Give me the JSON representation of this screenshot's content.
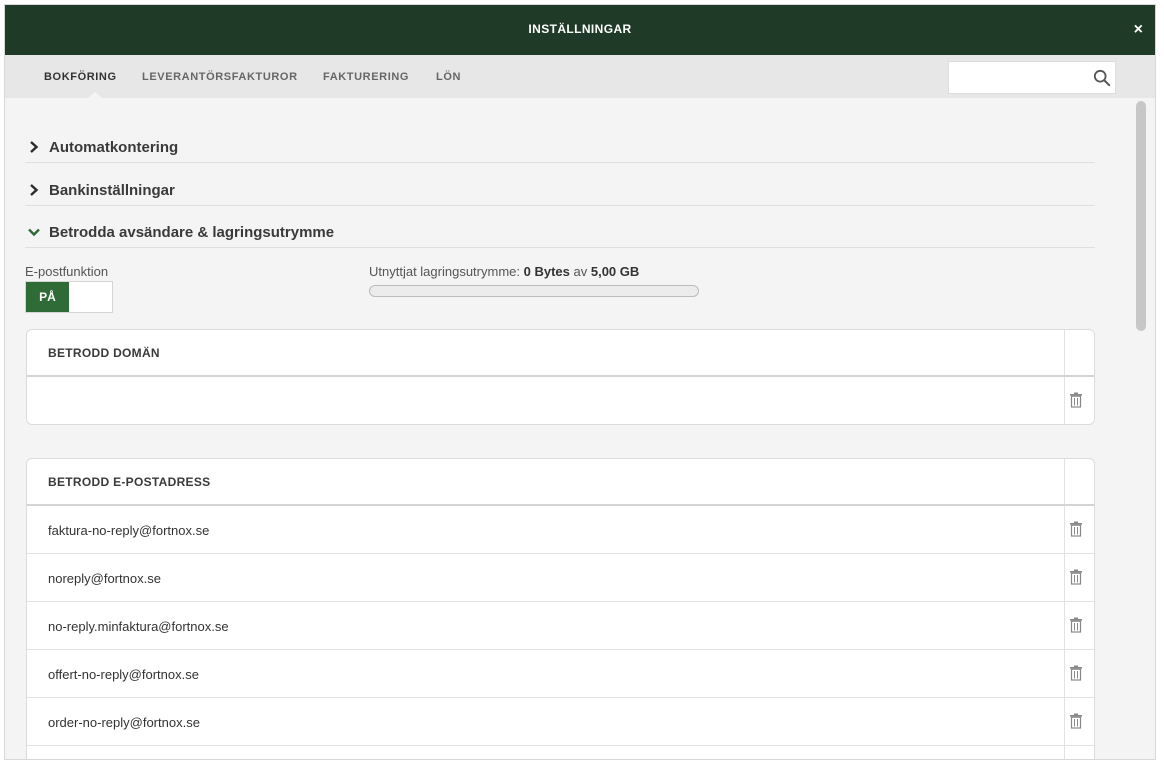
{
  "window": {
    "title": "INSTÄLLNINGAR",
    "close_label": "×"
  },
  "tabs": [
    {
      "label": "BOKFÖRING",
      "active": true
    },
    {
      "label": "LEVERANTÖRSFAKTUROR",
      "active": false
    },
    {
      "label": "FAKTURERING",
      "active": false
    },
    {
      "label": "LÖN",
      "active": false
    }
  ],
  "search": {
    "value": "",
    "placeholder": ""
  },
  "sections": [
    {
      "label": "Automatkontering",
      "expanded": false
    },
    {
      "label": "Bankinställningar",
      "expanded": false
    },
    {
      "label": "Betrodda avsändare & lagringsutrymme",
      "expanded": true
    }
  ],
  "email_function": {
    "label": "E-postfunktion",
    "toggle_label": "PÅ",
    "enabled": true
  },
  "storage": {
    "label": "Utnyttjat lagringsutrymme:",
    "used": "0 Bytes",
    "separator": "av",
    "total": "5,00 GB",
    "fraction": 0
  },
  "trusted_domain": {
    "header": "BETRODD DOMÄN",
    "rows": [
      ""
    ]
  },
  "trusted_email": {
    "header": "BETRODD E-POSTADRESS",
    "rows": [
      "faktura-no-reply@fortnox.se",
      "noreply@fortnox.se",
      "no-reply.minfaktura@fortnox.se",
      "offert-no-reply@fortnox.se",
      "order-no-reply@fortnox.se",
      ""
    ]
  },
  "colors": {
    "header_bg": "#1f3a26",
    "accent_green": "#2e6b37",
    "tabbar_bg": "#e7e7e7",
    "content_bg": "#f4f4f4"
  }
}
